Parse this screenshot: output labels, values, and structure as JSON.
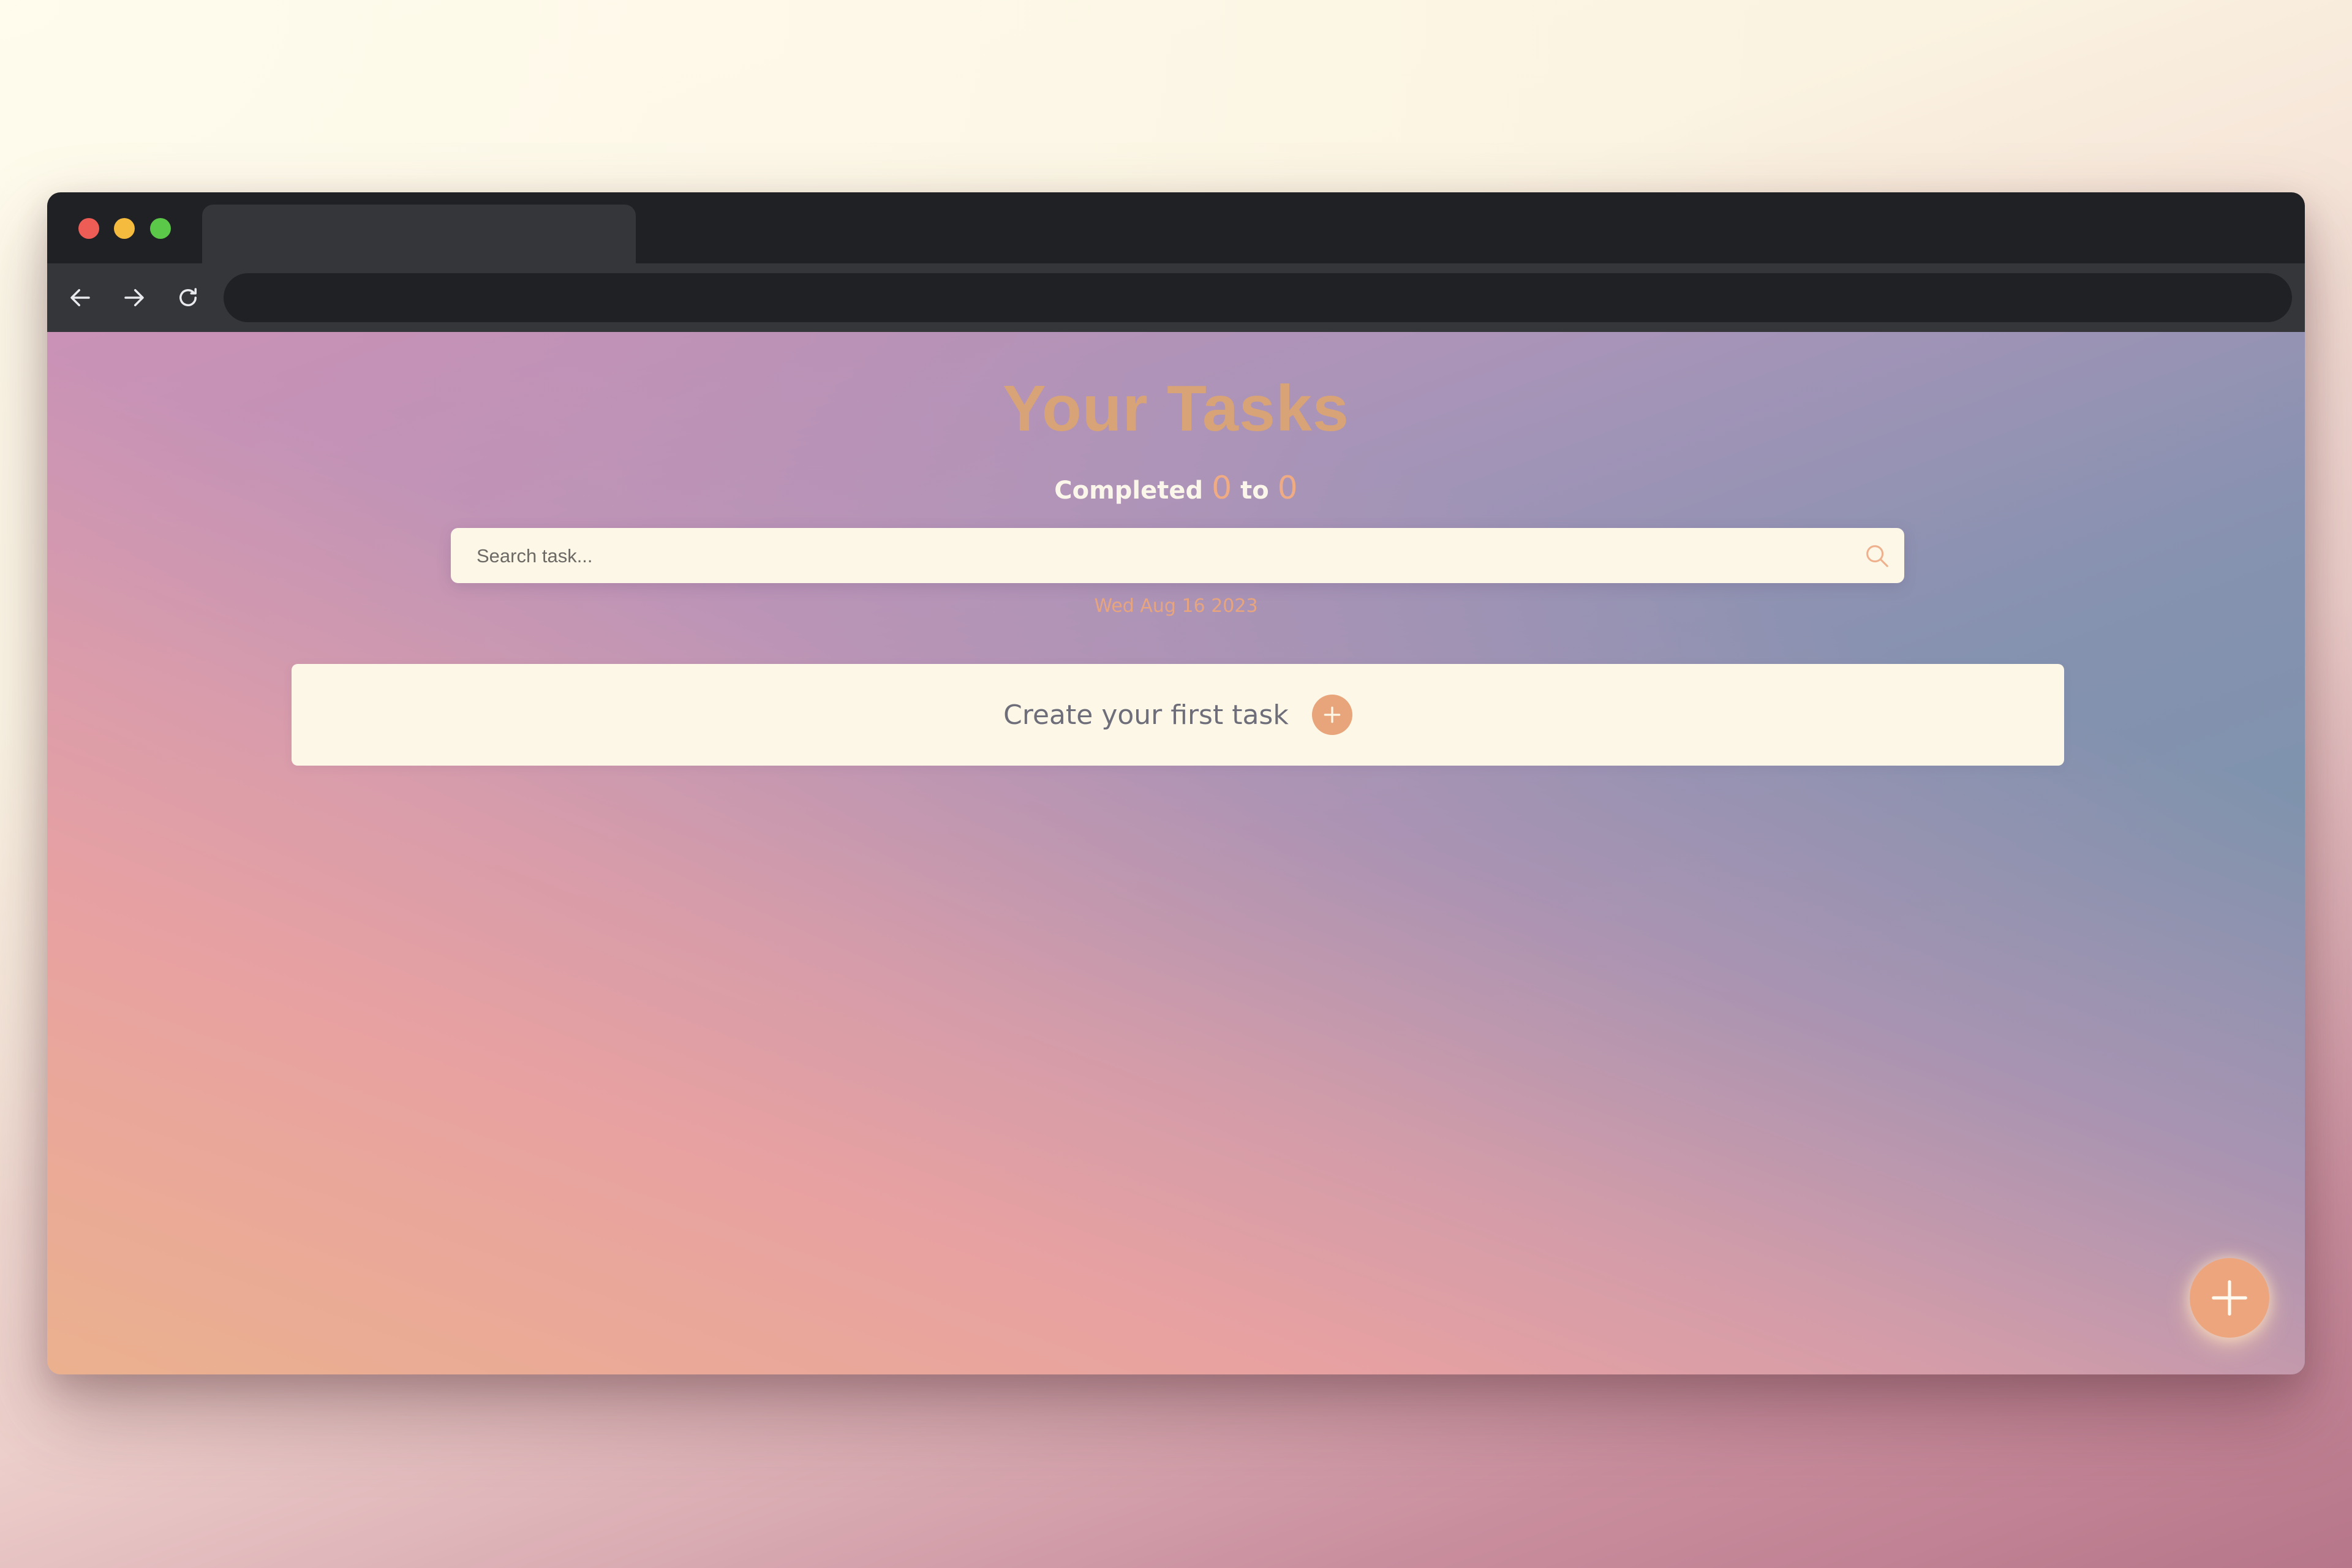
{
  "colors": {
    "accent": "#eda57d",
    "title": "#d8a377",
    "card_background": "#fcf7e6",
    "browser_chrome": "#202124"
  },
  "browser": {
    "tab_title": "",
    "address": "",
    "icons": [
      "arrow-left-icon",
      "arrow-right-icon",
      "reload-icon"
    ]
  },
  "header": {
    "title": "Your Tasks",
    "completed_label": "Completed",
    "completed_count": "0",
    "to_label": "to",
    "total_count": "0"
  },
  "search": {
    "placeholder": "Search task...",
    "value": "",
    "icon": "search-icon"
  },
  "date": "Wed Aug 16 2023",
  "empty_state": {
    "label": "Create your first task",
    "icon": "plus-icon"
  },
  "fab": {
    "icon": "plus-icon"
  }
}
